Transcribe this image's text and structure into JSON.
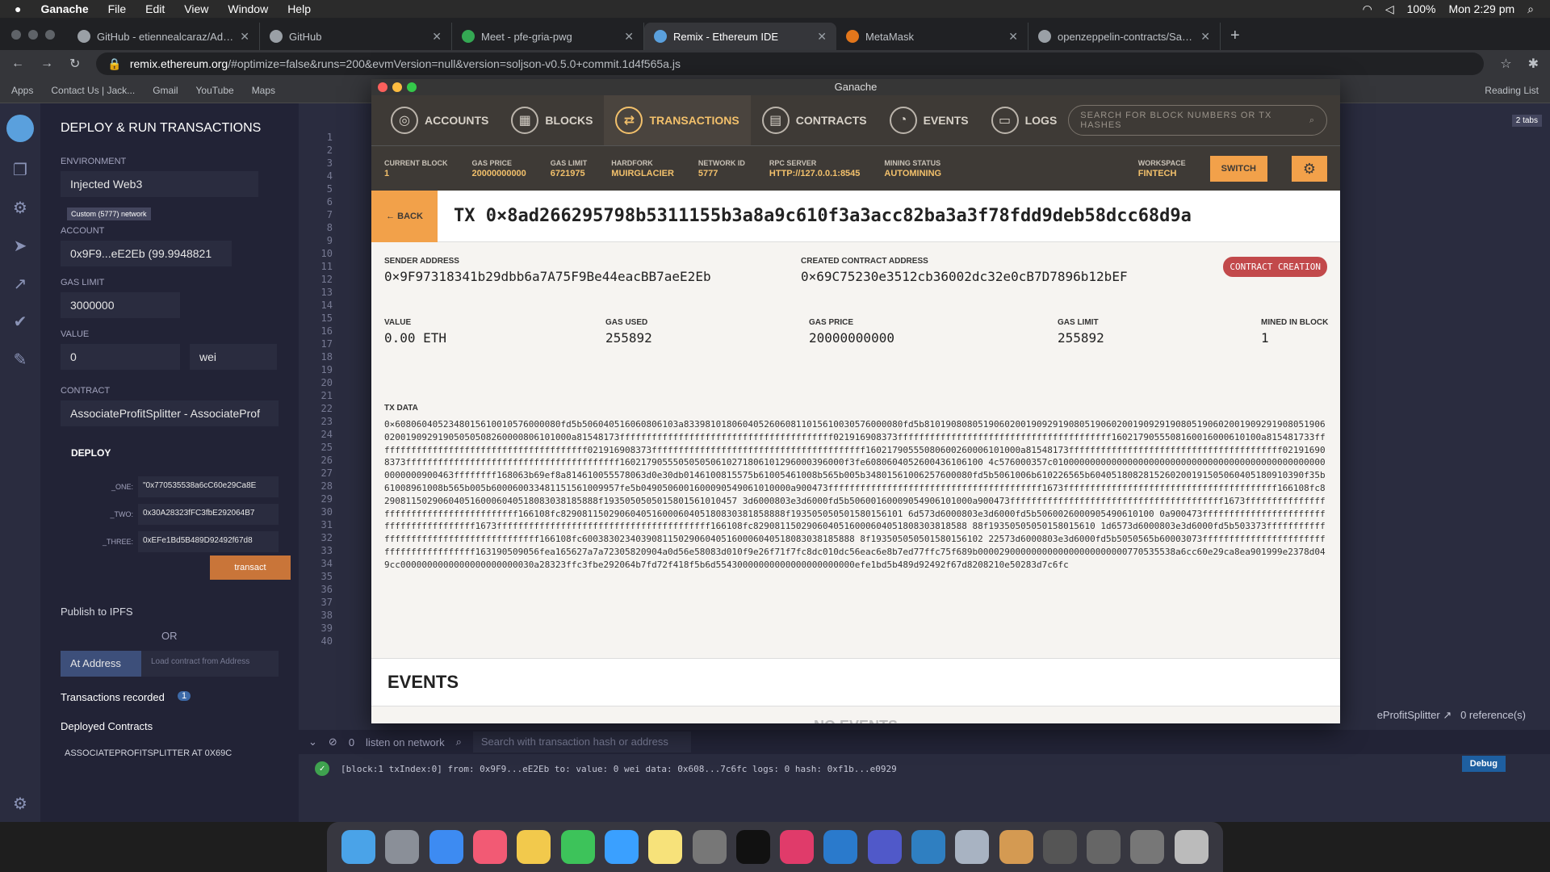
{
  "mac": {
    "app": "Ganache",
    "menus": [
      "File",
      "Edit",
      "View",
      "Window",
      "Help"
    ],
    "battery": "100%",
    "time": "Mon 2:29 pm"
  },
  "chrome": {
    "tabs": [
      {
        "title": "GitHub - etiennealcaraz/Advan",
        "color": "#9aa0a6"
      },
      {
        "title": "GitHub",
        "color": "#9aa0a6"
      },
      {
        "title": "Meet - pfe-gria-pwg",
        "color": "#34a853"
      },
      {
        "title": "Remix - Ethereum IDE",
        "color": "#5aa0dd"
      },
      {
        "title": "MetaMask",
        "color": "#e2761b"
      },
      {
        "title": "openzeppelin-contracts/SafeM",
        "color": "#9aa0a6"
      }
    ],
    "url_host": "remix.ethereum.org",
    "url_rest": "/#optimize=false&runs=200&evmVersion=null&version=soljson-v0.5.0+commit.1d4f565a.js",
    "bookmarks": [
      "Apps",
      "Contact Us | Jack...",
      "Gmail",
      "YouTube",
      "Maps"
    ],
    "reading_list": "Reading List"
  },
  "remix": {
    "title": "DEPLOY & RUN TRANSACTIONS",
    "env_label": "ENVIRONMENT",
    "env_value": "Injected Web3",
    "network_badge": "Custom (5777) network",
    "account_label": "ACCOUNT",
    "account_value": "0x9F9...eE2Eb (99.9948821",
    "gas_label": "GAS LIMIT",
    "gas_value": "3000000",
    "value_label": "VALUE",
    "value_value": "0",
    "value_unit": "wei",
    "contract_label": "CONTRACT",
    "contract_value": "AssociateProfitSplitter - AssociateProf",
    "deploy_label": "DEPLOY",
    "params": [
      {
        "k": "_ONE:",
        "v": "\"0x770535538a6cC60e29Ca8E"
      },
      {
        "k": "_TWO:",
        "v": "0x30A28323fFC3fbE292064B7"
      },
      {
        "k": "_THREE:",
        "v": "0xEFe1Bd5B489D92492f67d8"
      }
    ],
    "transact": "transact",
    "publish": "Publish to IPFS",
    "or": "OR",
    "at_address": "At Address",
    "load_placeholder": "Load contract from Address",
    "tx_recorded": "Transactions recorded",
    "tx_count": "1",
    "deployed": "Deployed Contracts",
    "deployed_item": "ASSOCIATEPROFITSPLITTER AT 0X69C",
    "line_numbers": [
      "1",
      "2",
      "3",
      "4",
      "5",
      "6",
      "7",
      "8",
      "9",
      "10",
      "11",
      "12",
      "13",
      "14",
      "15",
      "16",
      "17",
      "18",
      "19",
      "20",
      "21",
      "22",
      "23",
      "24",
      "25",
      "26",
      "27",
      "28",
      "29",
      "30",
      "31",
      "32",
      "33",
      "34",
      "35",
      "36",
      "37",
      "38",
      "39",
      "40"
    ],
    "listen": "listen on network",
    "term_search": "Search with transaction hash or address",
    "term_zero": "0",
    "log": "[block:1 txIndex:0]  from: 0x9F9...eE2Eb to:  value: 0 wei data: 0x608...7c6fc logs: 0 hash: 0xf1b...e0929",
    "debug": "Debug",
    "refs": "0 reference(s)",
    "profit": "eProfitSplitter",
    "two_tabs": "2 tabs"
  },
  "ganache": {
    "window_title": "Ganache",
    "nav": [
      {
        "label": "ACCOUNTS",
        "icon": "◎"
      },
      {
        "label": "BLOCKS",
        "icon": "▦"
      },
      {
        "label": "TRANSACTIONS",
        "icon": "⇄"
      },
      {
        "label": "CONTRACTS",
        "icon": "▤"
      },
      {
        "label": "EVENTS",
        "icon": "◔"
      },
      {
        "label": "LOGS",
        "icon": "▭"
      }
    ],
    "search_placeholder": "SEARCH FOR BLOCK NUMBERS OR TX HASHES",
    "stats": [
      {
        "k": "CURRENT BLOCK",
        "v": "1"
      },
      {
        "k": "GAS PRICE",
        "v": "20000000000"
      },
      {
        "k": "GAS LIMIT",
        "v": "6721975"
      },
      {
        "k": "HARDFORK",
        "v": "MUIRGLACIER"
      },
      {
        "k": "NETWORK ID",
        "v": "5777"
      },
      {
        "k": "RPC SERVER",
        "v": "HTTP://127.0.0.1:8545"
      },
      {
        "k": "MINING STATUS",
        "v": "AUTOMINING"
      }
    ],
    "workspace_label": "WORKSPACE",
    "workspace_value": "FINTECH",
    "switch": "SWITCH",
    "back": "← BACK",
    "tx_hash": "TX 0×8ad266295798b5311155b3a8a9c610f3a3acc82ba3a3f78fdd9deb58dcc68d9a",
    "sender_label": "SENDER ADDRESS",
    "sender": "0×9F97318341b29dbb6a7A75F9Be44eacBB7aeE2Eb",
    "created_label": "CREATED CONTRACT ADDRESS",
    "created": "0×69C75230e3512cb36002dc32e0cB7D7896b12bEF",
    "badge": "CONTRACT CREATION",
    "value_label": "VALUE",
    "value": "0.00 ETH",
    "gas_used_label": "GAS USED",
    "gas_used": "255892",
    "gas_price_label": "GAS PRICE",
    "gas_price": "20000000000",
    "gas_limit_label": "GAS LIMIT",
    "gas_limit": "255892",
    "mined_label": "MINED IN BLOCK",
    "mined": "1",
    "txdata_label": "TX DATA",
    "txdata": "0×6080604052348015610010576000080fd5b506040516060806103a83398101806040526060811015610030576000080fd5b81019080805190602001909291908051906020019092919080519060200190929190805190602001909291905050508260000806101000a81548173ffffffffffffffffffffffffffffffffffffffff021916908373ffffffffffffffffffffffffffffffffffffffff1602179055508160016000610100a815481733ffffffffffffffffffffffffffffffffffffffff021916908373ffffffffffffffffffffffffffffffffffffffff16021790555080600260006101000a81548173ffffffffffffffffffffffffffffffffffffffff021916908373ffffffffffffffffffffffffffffffffffffffff160217905550505050610271806101296000396000f3fe6080604052600436106100 4c576000357c0100000000000000000000000000000000000000000000000000000000900463ffffffff168063b69ef8a814610055578063d0e30db0146100815575b61005461008b565b005b34801561006257600080fd5b5061006b610226565b6040518082815260200191505060405180910390f35b61008961008b565b005b600060033481151561009957fe5b0490506001600090549061010000a900473ffffffffffffffffffffffffffffffffffffffff1673ffffffffffffffffffffffffffffffffffffffff166108fc82908115029060405160006040518083038185888f1935050505015801561010457 3d6000803e3d6000fd5b50600160009054906101000a900473ffffffffffffffffffffffffffffffffffffffff1673ffffffffffffffffffffffffffffffffffffffff166108fc829081150290604051600060405180830381858888f193505050501580156101 6d573d6000803e3d6000fd5b5060026000905490610100 0a900473ffffffffffffffffffffffffffffffffffffffff1673ffffffffffffffffffffffffffffffffffffffff166108fc8290811502906040516000604051808303818588 88f19350505050158015610 1d6573d6000803e3d6000fd5b503373ffffffffffffffffffffffffffffffffffffffff166108fc600383023403908115029060405160006040518083038185888 8f193505050501580156102 22573d6000803e3d6000fd5b5050565b60003073ffffffffffffffffffffffffffffffffffffffff163190509056fea165627a7a72305820904a0d56e58083d010f9e26f71f7fc8dc010dc56eac6e8b7ed77ffc75f689b0000290000000000000000000000770535538a6cc60e29ca8ea901999e2378d049cc0000000000000000000000030a28323ffc3fbe292064b7fd72f418f5b6d55430000000000000000000000efe1bd5b489d92492f67d8208210e50283d7c6fc",
    "events_title": "EVENTS",
    "no_events": "NO EVENTS"
  }
}
